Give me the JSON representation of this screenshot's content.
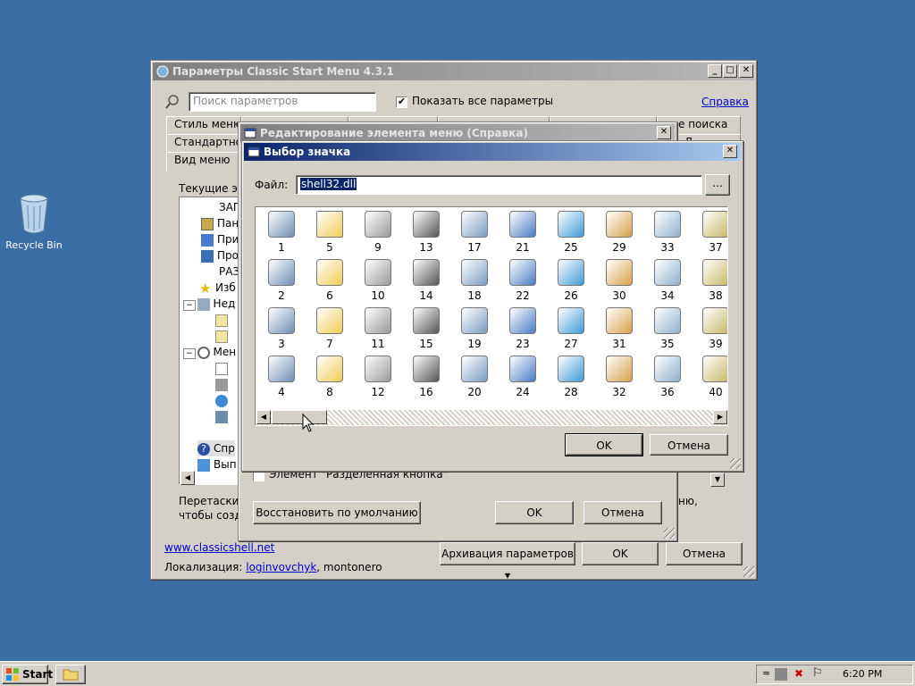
{
  "desktop": {
    "recycle_bin_label": "Recycle Bin"
  },
  "main_window": {
    "title": "Параметры Classic Start Menu 4.3.1",
    "search_placeholder": "Поиск параметров",
    "show_all_label": "Показать все параметры",
    "show_all_checked": "✔",
    "help_link": "Справка",
    "tabs_row1": [
      "Стиль меню",
      "оле поиска"
    ],
    "tabs_row2": [
      "Стандартное",
      "Д"
    ],
    "tabs_row3": [
      "Вид меню"
    ],
    "tree_label": "Текущие эл",
    "tree_items": [
      "ЗАГ",
      "Пан",
      "При",
      "Про",
      "РАЗ",
      "Изб",
      "Нед",
      "",
      "",
      "Мен",
      "",
      "",
      "",
      "",
      "Спр",
      "Вып"
    ],
    "hint_text_1": "Перетаские",
    "hint_text_2": "чтобы созд",
    "hint_right_1": "ню,",
    "hint_right_2": "",
    "website_link": "www.classicshell.net",
    "localization_label": "Локализация:",
    "localization_author_link": "loginvovchyk",
    "localization_other": ", montonero",
    "backup_button": "Архивация параметров",
    "ok_button": "OK",
    "cancel_button": "Отмена"
  },
  "edit_dialog": {
    "title": "Редактирование элемента меню (Справка)",
    "element_checkbox_label": "Элемент \"Разделенная кнопка\"",
    "restore_button": "Восстановить по умолчанию",
    "ok_button": "OK",
    "cancel_button": "Отмена"
  },
  "icon_dialog": {
    "title": "Выбор значка",
    "file_label": "Файл:",
    "file_value": "shell32.dll",
    "browse_button": "...",
    "ok_button": "OK",
    "cancel_button": "Отмена",
    "icon_numbers": [
      [
        "1",
        "5",
        "9",
        "13",
        "17",
        "21",
        "25",
        "29",
        "33",
        "37"
      ],
      [
        "2",
        "6",
        "10",
        "14",
        "18",
        "22",
        "26",
        "30",
        "34",
        "38"
      ],
      [
        "3",
        "7",
        "11",
        "15",
        "19",
        "23",
        "27",
        "31",
        "35",
        "39"
      ],
      [
        "4",
        "8",
        "12",
        "16",
        "20",
        "24",
        "28",
        "32",
        "36",
        "40"
      ]
    ]
  },
  "taskbar": {
    "start_label": "Start",
    "clock": "6:20 PM"
  },
  "colors": {
    "desktop": "#3a6ea5",
    "active_title_start": "#0a246a",
    "active_title_end": "#a6caf0",
    "inactive_title": "#808080"
  }
}
